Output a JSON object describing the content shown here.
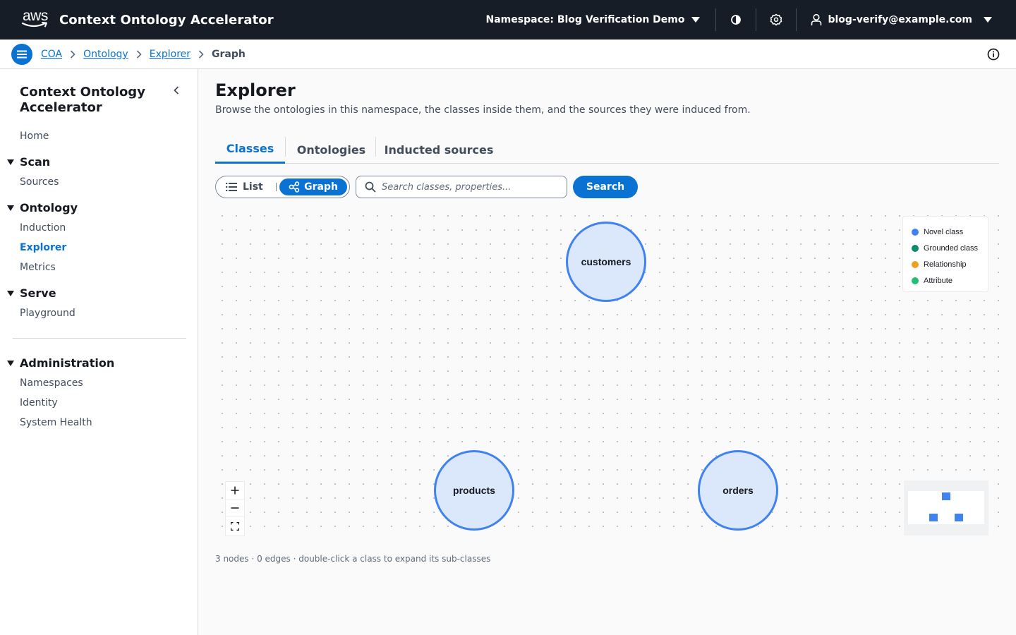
{
  "topbar": {
    "logo_text": "aws",
    "app_title": "Context Ontology Accelerator",
    "namespace_label": "Namespace: Blog Verification Demo",
    "user_email": "blog-verify@example.com"
  },
  "breadcrumb": {
    "items": [
      "COA",
      "Ontology",
      "Explorer"
    ],
    "current": "Graph"
  },
  "sidebar": {
    "title": "Context Ontology Accelerator",
    "home": "Home",
    "sections": [
      {
        "label": "Scan",
        "items": [
          "Sources"
        ]
      },
      {
        "label": "Ontology",
        "items": [
          "Induction",
          "Explorer",
          "Metrics"
        ]
      },
      {
        "label": "Serve",
        "items": [
          "Playground"
        ]
      },
      {
        "label": "Administration",
        "items": [
          "Namespaces",
          "Identity",
          "System Health"
        ]
      }
    ],
    "active_item": "Explorer"
  },
  "page": {
    "title": "Explorer",
    "description": "Browse the ontologies in this namespace, the classes inside them, and the sources they were induced from.",
    "tabs": [
      "Classes",
      "Ontologies",
      "Inducted sources"
    ],
    "active_tab": "Classes"
  },
  "toolbar": {
    "view_list": "List",
    "view_graph": "Graph",
    "active_view": "Graph",
    "search_placeholder": "Search classes, properties...",
    "search_value": "",
    "search_button": "Search"
  },
  "graph": {
    "nodes": [
      "customers",
      "products",
      "orders"
    ],
    "legend": [
      {
        "label": "Novel class",
        "color": "#3f82f0"
      },
      {
        "label": "Grounded class",
        "color": "#0f8a6e"
      },
      {
        "label": "Relationship",
        "color": "#f0a020"
      },
      {
        "label": "Attribute",
        "color": "#1fbf75"
      }
    ],
    "status": "3 nodes · 0 edges · double-click a class to expand its sub-classes"
  },
  "colors": {
    "topbar_bg": "#161d26",
    "accent": "#0972d3",
    "node_fill": "#dbe8fc",
    "node_stroke": "#3f82f0"
  }
}
